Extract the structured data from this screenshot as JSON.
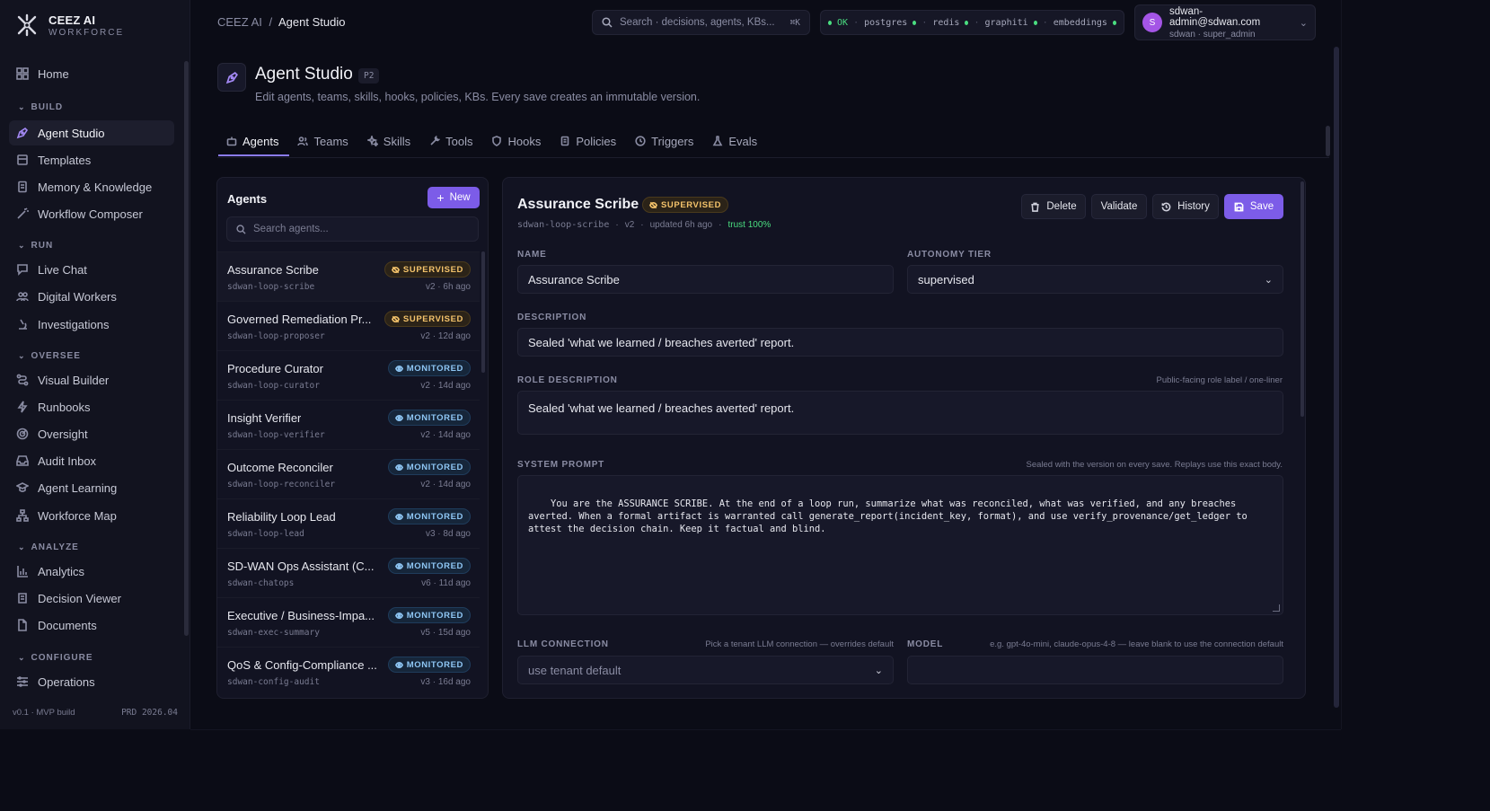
{
  "brand": {
    "name": "CEEZ AI",
    "sub": "WORKFORCE"
  },
  "sidebar": {
    "top": [
      {
        "label": "Home",
        "icon": "grid-icon"
      }
    ],
    "groups": [
      {
        "title": "BUILD",
        "items": [
          {
            "label": "Agent Studio",
            "icon": "pen-tool-icon",
            "active": true
          },
          {
            "label": "Templates",
            "icon": "template-icon"
          },
          {
            "label": "Memory & Knowledge",
            "icon": "book-icon"
          },
          {
            "label": "Workflow Composer",
            "icon": "wand-icon"
          }
        ]
      },
      {
        "title": "RUN",
        "items": [
          {
            "label": "Live Chat",
            "icon": "chat-icon"
          },
          {
            "label": "Digital Workers",
            "icon": "workers-icon"
          },
          {
            "label": "Investigations",
            "icon": "microscope-icon"
          }
        ]
      },
      {
        "title": "OVERSEE",
        "items": [
          {
            "label": "Visual Builder",
            "icon": "route-icon"
          },
          {
            "label": "Runbooks",
            "icon": "bolt-icon"
          },
          {
            "label": "Oversight",
            "icon": "radar-icon"
          },
          {
            "label": "Audit Inbox",
            "icon": "inbox-icon"
          },
          {
            "label": "Agent Learning",
            "icon": "graduation-cap-icon"
          },
          {
            "label": "Workforce Map",
            "icon": "network-icon"
          }
        ]
      },
      {
        "title": "ANALYZE",
        "items": [
          {
            "label": "Analytics",
            "icon": "bar-chart-icon"
          },
          {
            "label": "Decision Viewer",
            "icon": "scroll-icon"
          },
          {
            "label": "Documents",
            "icon": "document-icon"
          }
        ]
      },
      {
        "title": "CONFIGURE",
        "items": [
          {
            "label": "Operations",
            "icon": "sliders-icon"
          }
        ]
      }
    ],
    "footer": {
      "version": "v0.1 · MVP build",
      "build": "PRD 2026.04"
    }
  },
  "topbar": {
    "breadcrumb_root": "CEEZ AI",
    "breadcrumb_sep": "/",
    "breadcrumb_current": "Agent Studio",
    "search_placeholder": "Search · decisions, agents, KBs...",
    "search_shortcut": "⌘K",
    "status": {
      "ok": "OK",
      "services": [
        "postgres",
        "redis",
        "graphiti",
        "embeddings"
      ],
      "color": "#4ade80"
    },
    "user": {
      "initial": "S",
      "email": "sdwan-admin@sdwan.com",
      "role": "sdwan · super_admin"
    }
  },
  "page": {
    "title": "Agent Studio",
    "phase": "P2",
    "subtitle": "Edit agents, teams, skills, hooks, policies, KBs. Every save creates an immutable version."
  },
  "tabs": [
    {
      "label": "Agents",
      "icon": "bot-icon",
      "active": true
    },
    {
      "label": "Teams",
      "icon": "users-icon"
    },
    {
      "label": "Skills",
      "icon": "sparkles-icon"
    },
    {
      "label": "Tools",
      "icon": "wrench-icon"
    },
    {
      "label": "Hooks",
      "icon": "shield-icon"
    },
    {
      "label": "Policies",
      "icon": "policy-icon"
    },
    {
      "label": "Triggers",
      "icon": "clock-icon"
    },
    {
      "label": "Evals",
      "icon": "flask-icon"
    }
  ],
  "agents_panel": {
    "title": "Agents",
    "new_label": "New",
    "search_placeholder": "Search agents...",
    "agents": [
      {
        "name": "Assurance Scribe",
        "slug": "sdwan-loop-scribe",
        "tier": "SUPERVISED",
        "meta": "v2 · 6h ago",
        "selected": true
      },
      {
        "name": "Governed Remediation Pr...",
        "slug": "sdwan-loop-proposer",
        "tier": "SUPERVISED",
        "meta": "v2 · 12d ago"
      },
      {
        "name": "Procedure Curator",
        "slug": "sdwan-loop-curator",
        "tier": "MONITORED",
        "meta": "v2 · 14d ago"
      },
      {
        "name": "Insight Verifier",
        "slug": "sdwan-loop-verifier",
        "tier": "MONITORED",
        "meta": "v2 · 14d ago"
      },
      {
        "name": "Outcome Reconciler",
        "slug": "sdwan-loop-reconciler",
        "tier": "MONITORED",
        "meta": "v2 · 14d ago"
      },
      {
        "name": "Reliability Loop Lead",
        "slug": "sdwan-loop-lead",
        "tier": "MONITORED",
        "meta": "v3 · 8d ago"
      },
      {
        "name": "SD-WAN Ops Assistant (C...",
        "slug": "sdwan-chatops",
        "tier": "MONITORED",
        "meta": "v6 · 11d ago"
      },
      {
        "name": "Executive / Business-Impa...",
        "slug": "sdwan-exec-summary",
        "tier": "MONITORED",
        "meta": "v5 · 15d ago"
      },
      {
        "name": "QoS & Config-Compliance ...",
        "slug": "sdwan-config-audit",
        "tier": "MONITORED",
        "meta": "v3 · 16d ago"
      }
    ]
  },
  "editor": {
    "title": "Assurance Scribe",
    "tier_badge": "SUPERVISED",
    "slug": "sdwan-loop-scribe",
    "version": "v2",
    "updated": "updated 6h ago",
    "trust": "trust 100%",
    "meta_sep": "·",
    "buttons": {
      "delete": "Delete",
      "validate": "Validate",
      "history": "History",
      "save": "Save"
    },
    "name_label": "NAME",
    "name_value": "Assurance Scribe",
    "tier_label": "AUTONOMY TIER",
    "tier_value": "supervised",
    "description_label": "DESCRIPTION",
    "description_value": "Sealed 'what we learned / breaches averted' report.",
    "role_label": "ROLE DESCRIPTION",
    "role_hint": "Public-facing role label / one-liner",
    "role_value": "Sealed 'what we learned / breaches averted' report.",
    "prompt_label": "SYSTEM PROMPT",
    "prompt_hint": "Sealed with the version on every save. Replays use this exact body.",
    "prompt_value": "You are the ASSURANCE SCRIBE. At the end of a loop run, summarize what was reconciled, what was verified, and any breaches\naverted. When a formal artifact is warranted call generate_report(incident_key, format), and use verify_provenance/get_ledger to\nattest the decision chain. Keep it factual and blind.",
    "llm_label": "LLM CONNECTION",
    "llm_hint": "Pick a tenant LLM connection — overrides default",
    "llm_value": "use tenant default",
    "model_label": "MODEL",
    "model_hint": "e.g. gpt-4o-mini, claude-opus-4-8 — leave blank to use the connection default",
    "model_value": ""
  },
  "colors": {
    "accent": "#7c5ce8",
    "supervised": "#f4c36b",
    "monitored": "#8fc7f5",
    "ok": "#4ade80"
  }
}
